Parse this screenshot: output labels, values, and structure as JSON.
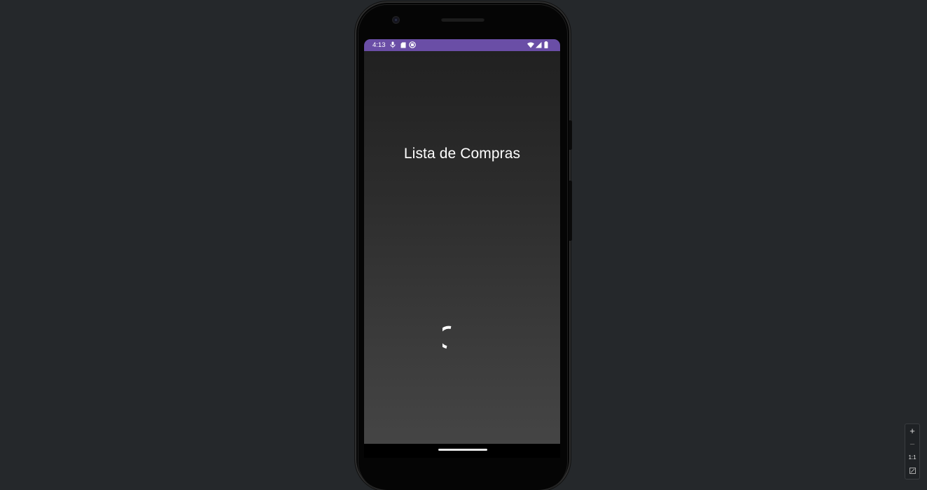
{
  "status_bar": {
    "time": "4:13",
    "color": "#6a4ea6",
    "left_icons": [
      "mic-icon",
      "sd-card-icon",
      "app-notification-icon"
    ],
    "right_icons": [
      "wifi-icon",
      "signal-icon",
      "battery-icon"
    ]
  },
  "app": {
    "title": "Lista de Compras",
    "loading": true
  },
  "zoom_controls": {
    "zoom_in_label": "+",
    "zoom_out_label": "−",
    "actual_size_label": "1:1",
    "fit_icon": "fit-screen-icon"
  }
}
